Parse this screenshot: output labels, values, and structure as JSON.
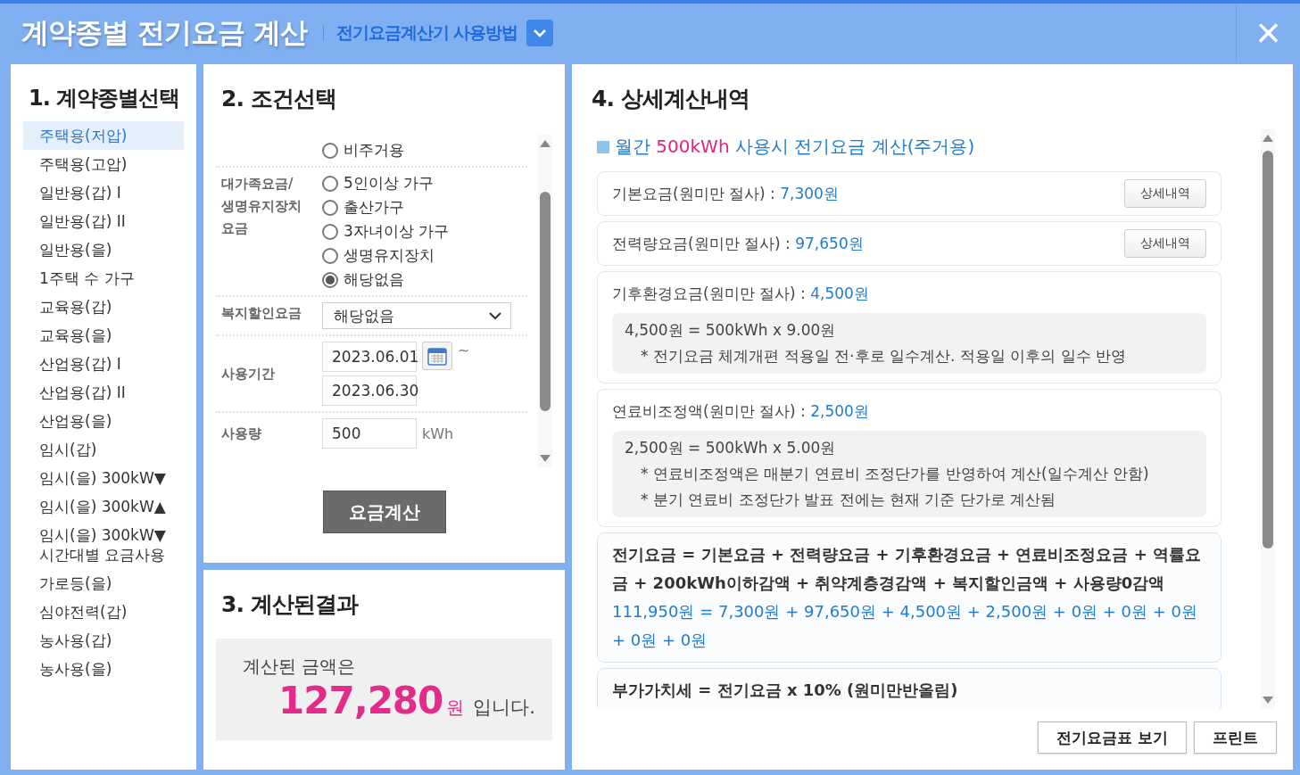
{
  "header": {
    "title": "계약종별 전기요금 계산",
    "help_link": "전기요금계산기 사용방법",
    "close": "×"
  },
  "contract_types": {
    "heading": "1. 계약종별선택",
    "items": [
      {
        "label": "주택용(저압)",
        "selected": true
      },
      {
        "label": "주택용(고압)",
        "selected": false
      },
      {
        "label": "일반용(갑) I",
        "selected": false
      },
      {
        "label": "일반용(갑) II",
        "selected": false
      },
      {
        "label": "일반용(을)",
        "selected": false
      },
      {
        "label": "1주택 수 가구",
        "selected": false
      },
      {
        "label": "교육용(갑)",
        "selected": false
      },
      {
        "label": "교육용(을)",
        "selected": false
      },
      {
        "label": "산업용(갑) I",
        "selected": false
      },
      {
        "label": "산업용(갑) II",
        "selected": false
      },
      {
        "label": "산업용(을)",
        "selected": false
      },
      {
        "label": "임시(갑)",
        "selected": false
      },
      {
        "label": "임시(을) 300kW▼",
        "selected": false
      },
      {
        "label": "임시(을) 300kW▲",
        "selected": false
      },
      {
        "label": "임시(을) 300kW▼ 시간대별 요금사용",
        "selected": false
      },
      {
        "label": "가로등(을)",
        "selected": false
      },
      {
        "label": "심야전력(갑)",
        "selected": false
      },
      {
        "label": "농사용(갑)",
        "selected": false
      },
      {
        "label": "농사용(을)",
        "selected": false
      }
    ]
  },
  "conditions": {
    "heading": "2. 조건선택",
    "fields": [
      {
        "kind": "radio",
        "options": [
          {
            "label": "비주거용",
            "selected": false
          }
        ]
      },
      {
        "kind": "radio",
        "label": "대가족요금/ 생명유지장치 요금",
        "options": [
          {
            "label": "5인이상 가구",
            "selected": false
          },
          {
            "label": "출산가구",
            "selected": false
          },
          {
            "label": "3자녀이상 가구",
            "selected": false
          },
          {
            "label": "생명유지장치",
            "selected": false
          },
          {
            "label": "해당없음",
            "selected": true
          }
        ]
      },
      {
        "kind": "select",
        "label": "복지할인요금",
        "value": "해당없음"
      },
      {
        "kind": "dates",
        "label": "사용기간",
        "start": "2023.06.01",
        "separator": "~",
        "end": "2023.06.30"
      },
      {
        "kind": "amount",
        "label": "사용량",
        "value": "500",
        "unit": "kWh"
      }
    ],
    "calculate_button": "요금계산"
  },
  "result": {
    "heading": "3. 계산된결과",
    "prefix": "계산된 금액은",
    "amount": "127,280",
    "unit": "원",
    "suffix": "입니다."
  },
  "details": {
    "heading": "4. 상세계산내역",
    "summary": {
      "before": "월간",
      "highlight": "500kWh",
      "after": "사용시 전기요금 계산(주거용)"
    },
    "items": [
      {
        "kind": "charge",
        "label": "기본요금(원미만 절사) :",
        "value": "7,300원",
        "button": "상세내역"
      },
      {
        "kind": "charge",
        "label": "전력량요금(원미만 절사) :",
        "value": "97,650원",
        "button": "상세내역"
      },
      {
        "kind": "charge",
        "label": "기후환경요금(원미만 절사) :",
        "value": "4,500원",
        "formula": "4,500원 = 500kWh x 9.00원",
        "notes": [
          "* 전기요금 체계개편 적용일 전·후로 일수계산. 적용일 이후의 일수 반영"
        ]
      },
      {
        "kind": "charge",
        "label": "연료비조정액(원미만 절사) :",
        "value": "2,500원",
        "formula": "2,500원 = 500kWh x 5.00원",
        "notes": [
          "* 연료비조정액은 매분기 연료비 조정단가를 반영하여 계산(일수계산 안함)",
          "* 분기 연료비 조정단가 발표 전에는 현재 기준 단가로 계산됨"
        ]
      },
      {
        "kind": "total",
        "label": "전기요금 = 기본요금 + 전력량요금 + 기후환경요금 + 연료비조정요금 + 역률요금 + 200kWh이하감액 + 취약계층경감액 + 복지할인금액 + 사용량0감액",
        "value": "111,950원 = 7,300원 + 97,650원 + 4,500원 + 2,500원 + 0원 + 0원 + 0원 + 0원 + 0원"
      },
      {
        "kind": "total",
        "label": "부가가치세 = 전기요금 x 10% (원미만반올림)"
      }
    ]
  },
  "footer_buttons": [
    "전기요금표 보기",
    "프린트"
  ]
}
